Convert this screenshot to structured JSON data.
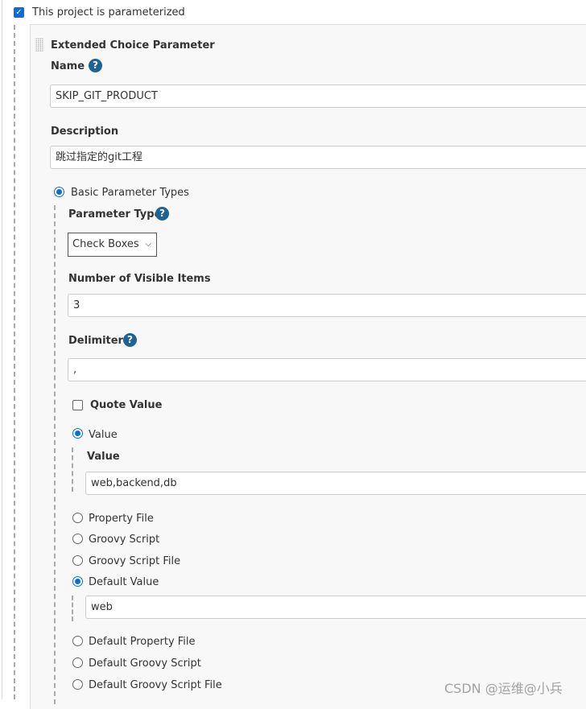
{
  "parameterized": {
    "label": "This project is parameterized",
    "checked": true
  },
  "param": {
    "title": "Extended Choice Parameter",
    "name_label": "Name",
    "name_value": "SKIP_GIT_PRODUCT",
    "desc_label": "Description",
    "desc_value": "跳过指定的git工程",
    "basic_label": "Basic Parameter Types",
    "type_label": "Parameter Type",
    "type_value": "Check Boxes",
    "visible_label": "Number of Visible Items",
    "visible_value": "3",
    "delim_label": "Delimiter",
    "delim_value": ",",
    "quote_label": "Quote Value",
    "quote_checked": false,
    "value_radio": "Value",
    "value_label": "Value",
    "value_value": "web,backend,db",
    "sources": [
      "Property File",
      "Groovy Script",
      "Groovy Script File"
    ],
    "default_value_radio": "Default Value",
    "default_value": "web",
    "default_sources": [
      "Default Property File",
      "Default Groovy Script",
      "Default Groovy Script File"
    ]
  },
  "help_icon": "?",
  "watermark": "CSDN @运维@小兵",
  "colors": {
    "accent": "#0b6cd8",
    "help": "#1f6296"
  }
}
